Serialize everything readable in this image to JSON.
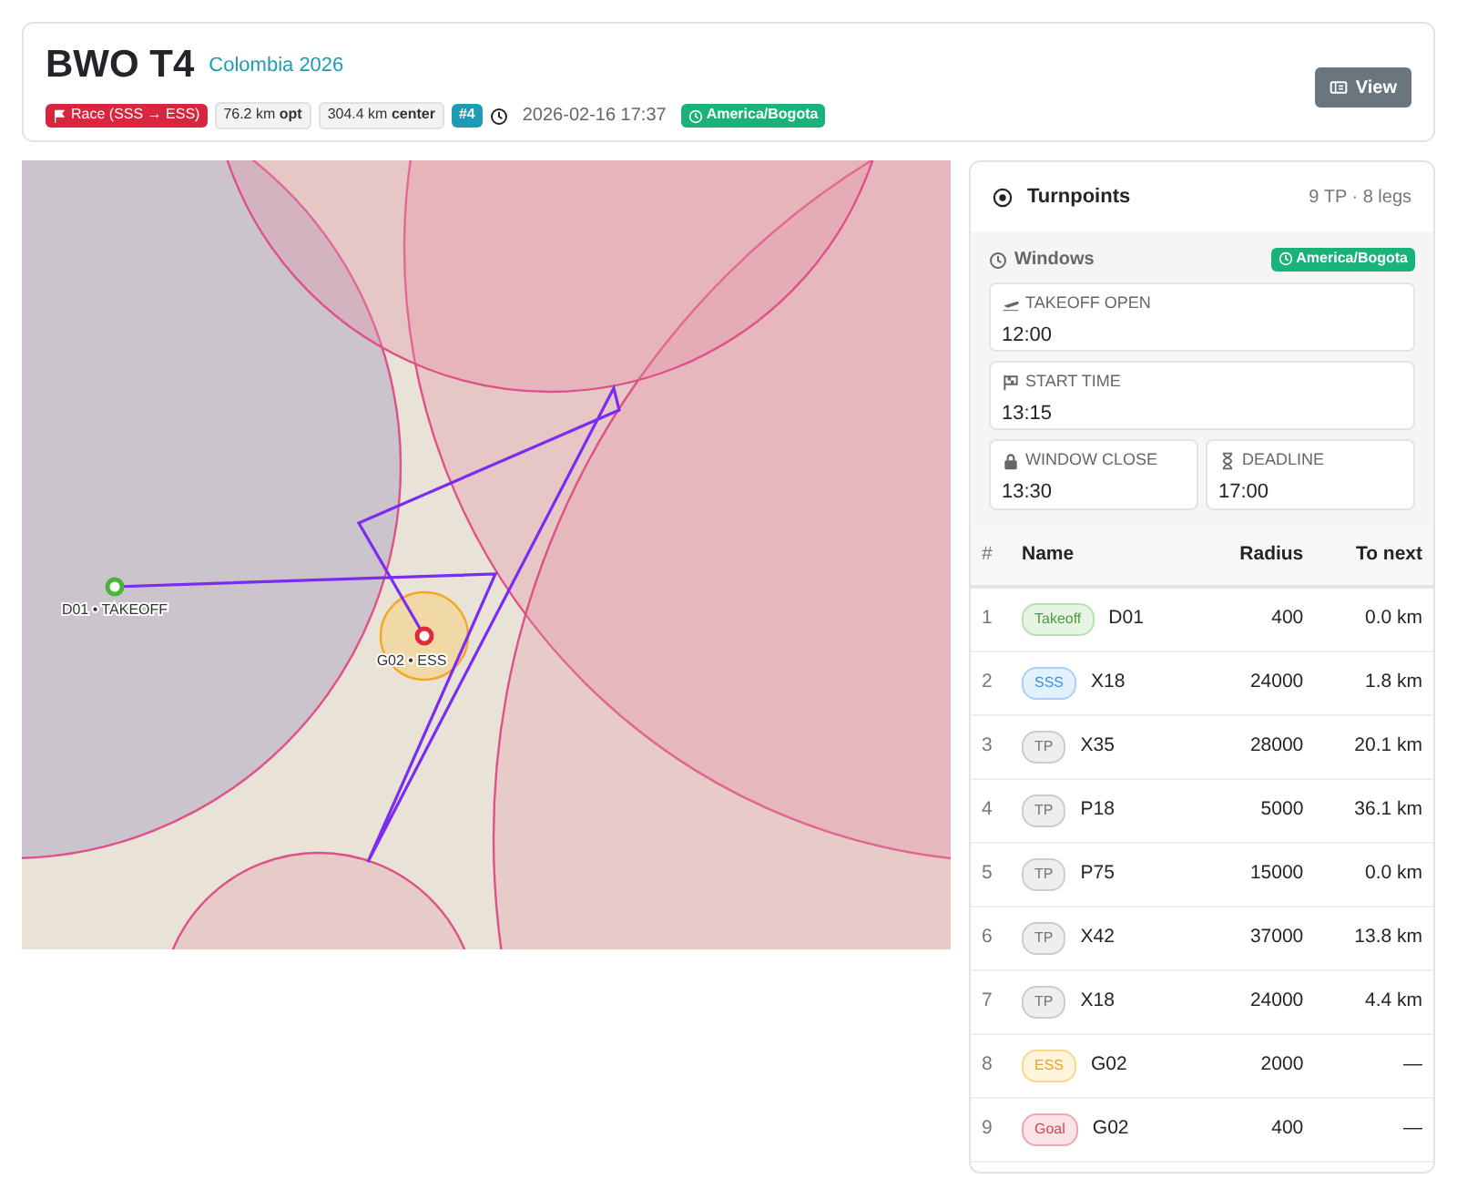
{
  "header": {
    "title": "BWO T4",
    "subtitle": "Colombia 2026",
    "badges": [
      {
        "kind": "race",
        "text": "Race (SSS → ESS)"
      },
      {
        "kind": "distance",
        "text": "76.2 km **opt**"
      },
      {
        "kind": "distance",
        "text": "304.4 km **center**"
      },
      {
        "kind": "number",
        "text": "#4"
      },
      {
        "kind": "time",
        "text": "2026-02-16 17:37"
      },
      {
        "kind": "timezone",
        "text": "America/Bogota"
      }
    ],
    "view_button": "View"
  },
  "map": {
    "labels": [
      {
        "kind": "takeoff",
        "text": "D01 • TAKEOFF"
      },
      {
        "kind": "goal",
        "text": "G02 • ESS"
      }
    ]
  },
  "turnpoints": {
    "title": "Turnpoints",
    "summary": "9 TP · 8 legs",
    "windows": {
      "title": "Windows",
      "timezone": "America/Bogota",
      "items": [
        {
          "kind": "takeoff",
          "label": "TAKEOFF OPEN",
          "value": "12:00"
        },
        {
          "kind": "start",
          "label": "START TIME",
          "value": "13:15"
        },
        {
          "kind": "close",
          "label": "WINDOW CLOSE",
          "value": "13:30"
        },
        {
          "kind": "deadline",
          "label": "DEADLINE",
          "value": "17:00"
        }
      ]
    },
    "columns": [
      "#",
      "Name",
      "Radius",
      "To next"
    ],
    "rows": [
      {
        "num": "1",
        "kind": "takeoff",
        "tag": "Takeoff",
        "name": "D01",
        "radius": "400",
        "to_next": "0.0 km"
      },
      {
        "num": "2",
        "kind": "sss",
        "tag": "SSS",
        "name": "X18",
        "radius": "24000",
        "to_next": "1.8 km"
      },
      {
        "num": "3",
        "kind": "tp",
        "tag": "TP",
        "name": "X35",
        "radius": "28000",
        "to_next": "20.1 km"
      },
      {
        "num": "4",
        "kind": "tp",
        "tag": "TP",
        "name": "P18",
        "radius": "5000",
        "to_next": "36.1 km"
      },
      {
        "num": "5",
        "kind": "tp",
        "tag": "TP",
        "name": "P75",
        "radius": "15000",
        "to_next": "0.0 km"
      },
      {
        "num": "6",
        "kind": "tp",
        "tag": "TP",
        "name": "X42",
        "radius": "37000",
        "to_next": "13.8 km"
      },
      {
        "num": "7",
        "kind": "tp",
        "tag": "TP",
        "name": "X18",
        "radius": "24000",
        "to_next": "4.4 km"
      },
      {
        "num": "8",
        "kind": "ess",
        "tag": "ESS",
        "name": "G02",
        "radius": "2000",
        "to_next": "—"
      },
      {
        "num": "9",
        "kind": "goal",
        "tag": "Goal",
        "name": "G02",
        "radius": "400",
        "to_next": "—"
      }
    ]
  }
}
